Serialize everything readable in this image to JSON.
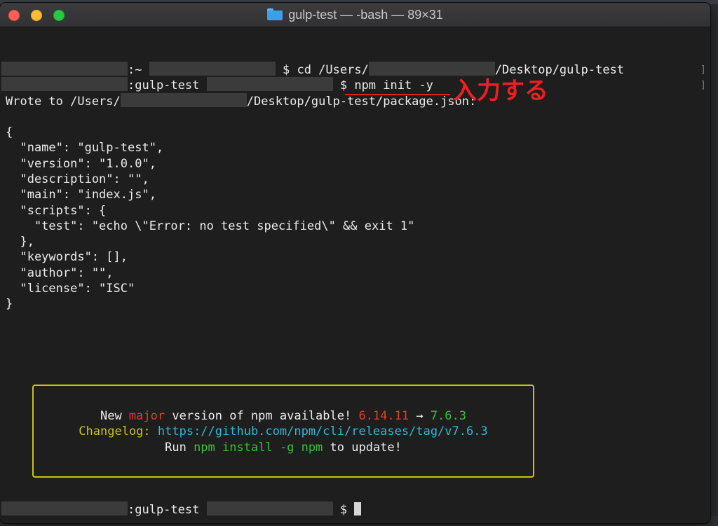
{
  "window": {
    "title": "gulp-test — -bash — 89×31",
    "title_icon": "folder-icon"
  },
  "terminal": {
    "line1": {
      "host_suffix": ":~",
      "prompt": "$ cd /Users/",
      "path_tail": "/Desktop/gulp-test"
    },
    "line2": {
      "host_suffix": ":gulp-test",
      "prompt": "$ npm init -y"
    },
    "line3": {
      "prefix": "Wrote to /Users/",
      "suffix": "/Desktop/gulp-test/package.json:"
    },
    "json_lines": [
      "{",
      "  \"name\": \"gulp-test\",",
      "  \"version\": \"1.0.0\",",
      "  \"description\": \"\",",
      "  \"main\": \"index.js\",",
      "  \"scripts\": {",
      "    \"test\": \"echo \\\"Error: no test specified\\\" && exit 1\"",
      "  },",
      "  \"keywords\": [],",
      "  \"author\": \"\",",
      "  \"license\": \"ISC\"",
      "}"
    ],
    "last_line": {
      "host_suffix": ":gulp-test",
      "prompt": "$"
    }
  },
  "annotation": {
    "text": "入力する",
    "color": "#f01e1e"
  },
  "npm_notice": {
    "line1": {
      "a": "New ",
      "b": "major",
      "c": " version of npm available! ",
      "d": "6.14.11",
      "e": " → ",
      "f": "7.6.3"
    },
    "line2": {
      "a": "Changelog: ",
      "b": "https://github.com/npm/cli/releases/tag/v7.6.3"
    },
    "line3": {
      "a": "Run ",
      "b": "npm install -g npm",
      "c": " to update!"
    },
    "border_color": "#c8c414"
  }
}
